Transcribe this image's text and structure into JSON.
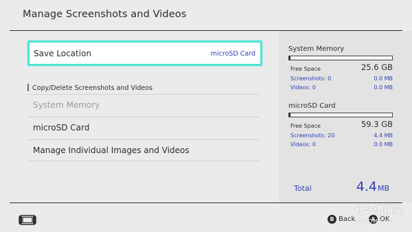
{
  "header": {
    "title": "Manage Screenshots and Videos"
  },
  "save_location": {
    "label": "Save Location",
    "value": "microSD Card"
  },
  "section": {
    "title": "Copy/Delete Screenshots and Videos"
  },
  "menu": {
    "items": [
      {
        "label": "System Memory",
        "enabled": false
      },
      {
        "label": "microSD Card",
        "enabled": true
      },
      {
        "label": "Manage Individual Images and Videos",
        "enabled": true
      }
    ]
  },
  "storage": [
    {
      "name": "System Memory",
      "used_fraction": 0.01,
      "free_label": "Free Space",
      "free_value": "25.6 GB",
      "screenshots_label": "Screenshots: 0",
      "screenshots_size": "0.0 MB",
      "videos_label": "Videos: 0",
      "videos_size": "0.0 MB"
    },
    {
      "name": "microSD Card",
      "used_fraction": 0.01,
      "free_label": "Free Space",
      "free_value": "59.3 GB",
      "screenshots_label": "Screenshots: 20",
      "screenshots_size": "4.4 MB",
      "videos_label": "Videos: 0",
      "videos_size": "0.0 MB"
    }
  ],
  "total": {
    "label": "Total",
    "value": "4.4",
    "unit": "MB"
  },
  "footer": {
    "back_button": "B",
    "back_label": "Back",
    "ok_button": "A",
    "ok_label": "OK"
  },
  "watermark": {
    "text": "什么值得买",
    "sub": "SMZDM.COM"
  },
  "colors": {
    "accent": "#4fe3d5",
    "link_blue": "#2f3fb7",
    "background": "#ebebeb",
    "panel": "#e3e3e3"
  }
}
